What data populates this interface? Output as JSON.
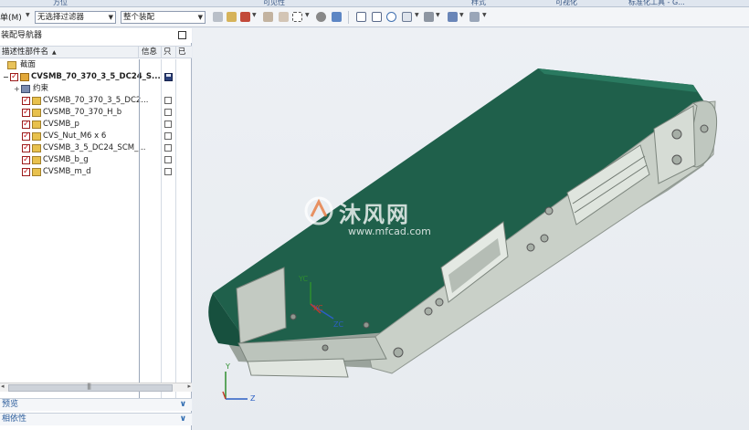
{
  "ribbon": {
    "groups": [
      "方位",
      "可见性",
      "样式",
      "可视化",
      "标准化工具 - G..."
    ]
  },
  "toolbar": {
    "menu_label": "单(M)",
    "filter_select": "无选择过滤器",
    "scope_select": "整个装配"
  },
  "navigator": {
    "title": "装配导航器",
    "columns": {
      "name": "描述性部件名",
      "info": "信息",
      "read_only": "只",
      "modified": "已"
    },
    "rows": [
      {
        "label": "截面",
        "icon": "section-folder-icon",
        "level": 0,
        "checkbox": false
      },
      {
        "label": "CVSMB_70_370_3_5_DC24_S...",
        "icon": "assembly-icon",
        "level": 0,
        "checkbox": true,
        "bold": true,
        "expander": "−"
      },
      {
        "label": "约束",
        "icon": "constraints-icon",
        "level": 1,
        "checkbox": false,
        "expander": "+"
      },
      {
        "label": "CVSMB_70_370_3_5_DC2...",
        "icon": "part-icon",
        "level": 1,
        "checkbox": true
      },
      {
        "label": "CVSMB_70_370_H_b",
        "icon": "part-icon",
        "level": 1,
        "checkbox": true
      },
      {
        "label": "CVSMB_p",
        "icon": "part-icon",
        "level": 1,
        "checkbox": true
      },
      {
        "label": "CVS_Nut_M6 x 6",
        "icon": "part-icon",
        "level": 1,
        "checkbox": true
      },
      {
        "label": "CVSMB_3_5_DC24_SCM_...",
        "icon": "part-icon",
        "level": 1,
        "checkbox": true
      },
      {
        "label": "CVSMB_b_g",
        "icon": "part-icon",
        "level": 1,
        "checkbox": true
      },
      {
        "label": "CVSMB_m_d",
        "icon": "part-icon",
        "level": 1,
        "checkbox": true
      }
    ]
  },
  "panels": {
    "preview": "预览",
    "dependencies": "相依性"
  },
  "viewport": {
    "watermark_text": "沐风网",
    "watermark_url": "www.mfcad.com",
    "axis": {
      "x": "XC",
      "y": "YC",
      "z": "ZC",
      "triad_y": "Y",
      "triad_z": "Z"
    }
  },
  "colors": {
    "belt": "#1d5e4a",
    "frame": "#c9d0c8",
    "accent_blue": "#2c5d9c"
  }
}
